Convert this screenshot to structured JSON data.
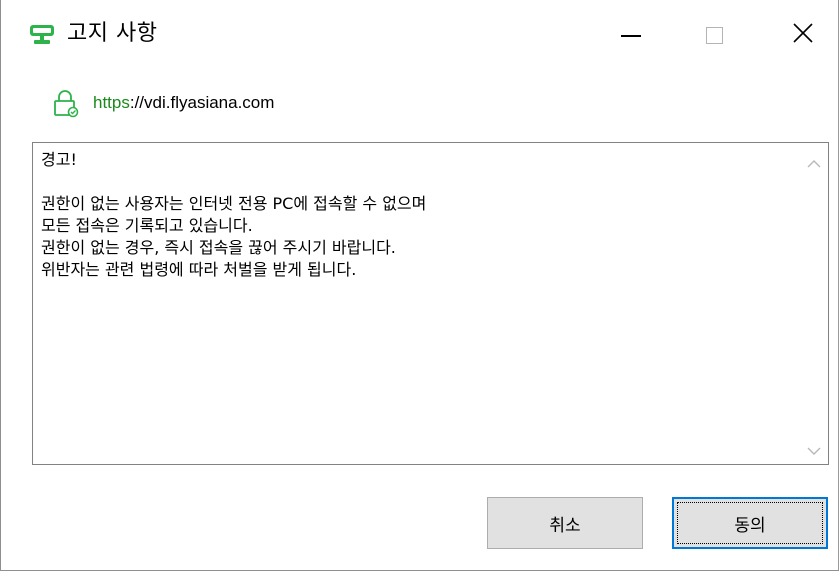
{
  "window": {
    "title": "고지 사항",
    "accent_color": "#2db34a"
  },
  "address": {
    "scheme": "https",
    "rest": "://vdi.flyasiana.com"
  },
  "notice": {
    "text": "경고!\n\n권한이 없는 사용자는 인터넷 전용 PC에 접속할 수 없으며\n모든 접속은 기록되고 있습니다.\n권한이 없는 경우, 즉시 접속을 끊어 주시기 바랍니다.\n위반자는 관련 법령에 따라 처벌을 받게 됩니다."
  },
  "buttons": {
    "cancel": "취소",
    "agree": "동의"
  },
  "icons": {
    "app": "monitor-icon",
    "lock": "lock-icon",
    "minimize": "minimize-icon",
    "maximize": "maximize-icon",
    "close": "close-icon",
    "scroll_up": "chevron-up-icon",
    "scroll_down": "chevron-down-icon"
  }
}
